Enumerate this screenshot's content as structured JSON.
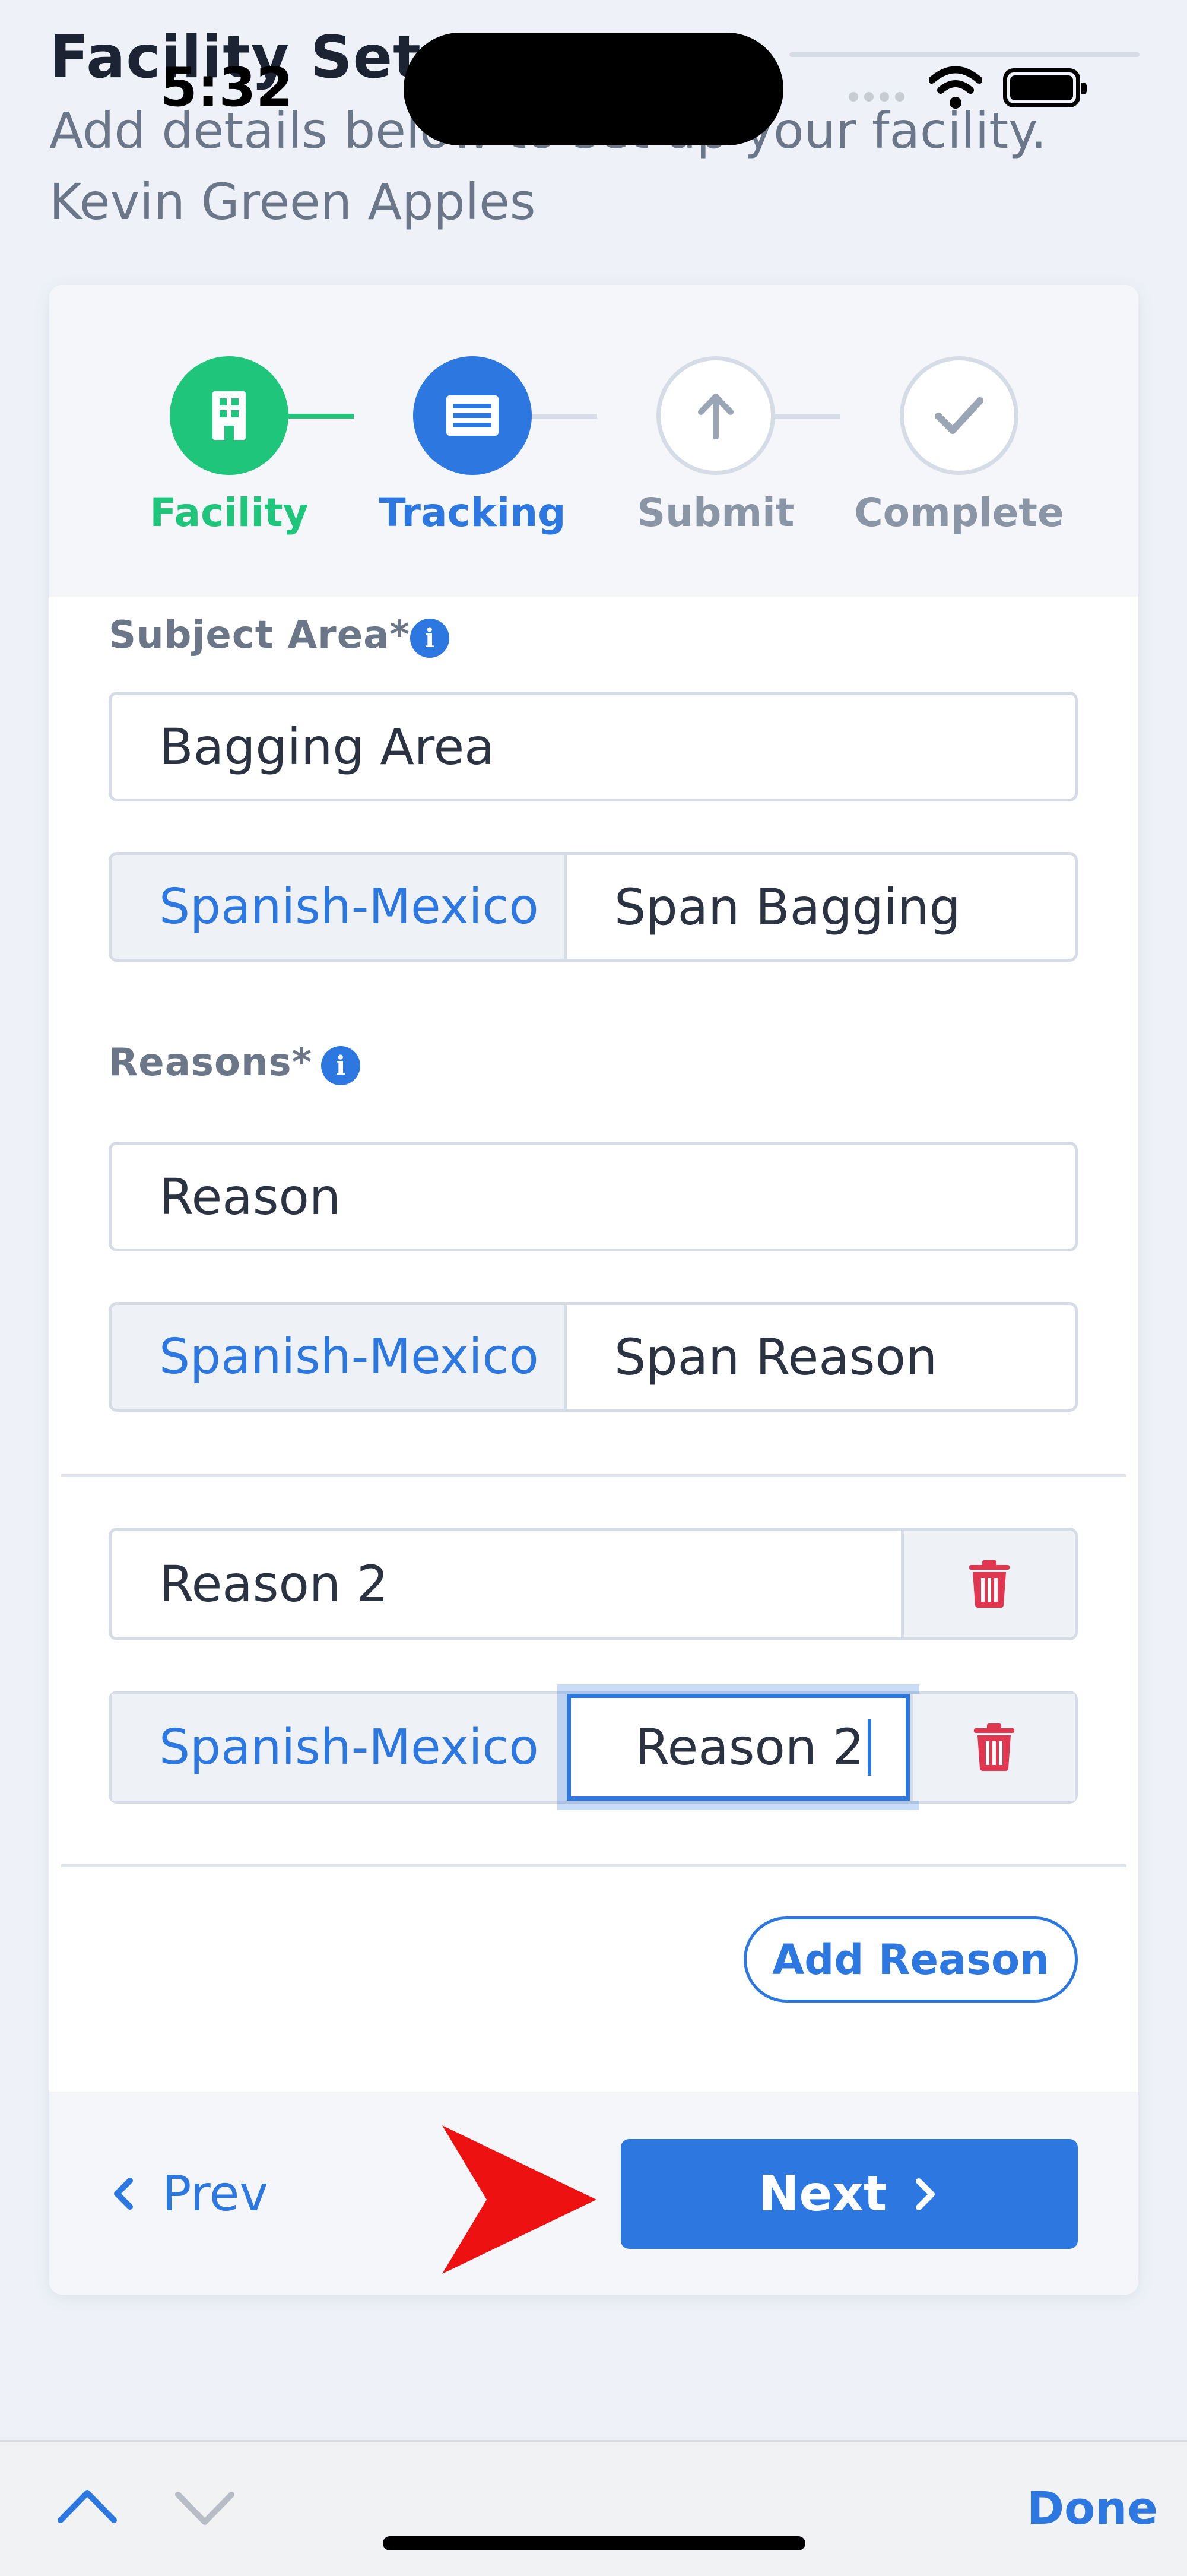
{
  "status_bar": {
    "time": "5:32"
  },
  "header": {
    "title": "Facility Setup",
    "subtitle": "Add details below to set up your facility. Kevin Green Apples"
  },
  "stepper": {
    "steps": [
      {
        "label": "Facility",
        "state": "done",
        "icon": "building-icon"
      },
      {
        "label": "Tracking",
        "state": "active",
        "icon": "list-icon"
      },
      {
        "label": "Submit",
        "state": "pending",
        "icon": "arrow-up-icon"
      },
      {
        "label": "Complete",
        "state": "pending",
        "icon": "check-icon"
      }
    ],
    "colors": {
      "done": "#1ec57a",
      "active": "#2d78e0",
      "pending": "#9aa5b5"
    }
  },
  "subject_area": {
    "label": "Subject Area*",
    "value": "Bagging Area",
    "translation": {
      "language": "Spanish-Mexico",
      "value": "Span Bagging"
    }
  },
  "reasons": {
    "label": "Reasons*",
    "items": [
      {
        "value": "Reason",
        "translation": {
          "language": "Spanish-Mexico",
          "value": "Span Reason"
        }
      },
      {
        "value": "Reason 2",
        "translation": {
          "language": "Spanish-Mexico",
          "value": "Reason 2"
        }
      }
    ],
    "add_button": "Add Reason"
  },
  "footer": {
    "prev_label": "Prev",
    "next_label": "Next"
  },
  "keyboard_bar": {
    "done_label": "Done"
  },
  "colors": {
    "accent": "#2d78e0",
    "danger": "#e0364f",
    "success": "#1ec57a"
  }
}
